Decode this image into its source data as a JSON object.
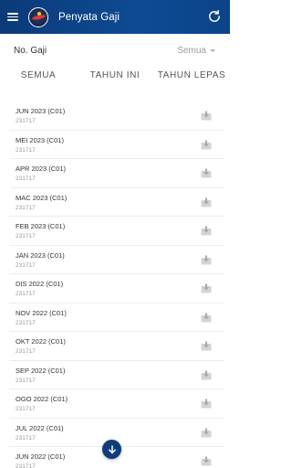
{
  "appbar": {
    "title": "Penyata Gaji",
    "menu_icon": "hamburger-menu-icon",
    "logo_icon": "app-logo",
    "refresh_icon": "refresh-icon",
    "color": "#0d4b94"
  },
  "filter": {
    "label": "No. Gaji",
    "selected": "Semua"
  },
  "tabs": [
    {
      "label": "SEMUA"
    },
    {
      "label": "TAHUN INI"
    },
    {
      "label": "TAHUN LEPAS"
    }
  ],
  "statements": [
    {
      "month": "JUN 2023 (C01)",
      "code": "231717"
    },
    {
      "month": "MEI 2023 (C01)",
      "code": "231717"
    },
    {
      "month": "APR 2023 (C01)",
      "code": "231717"
    },
    {
      "month": "MAC 2023 (C01)",
      "code": "231717"
    },
    {
      "month": "FEB 2023 (C01)",
      "code": "231717"
    },
    {
      "month": "JAN 2023 (C01)",
      "code": "231717"
    },
    {
      "month": "DIS 2022 (C01)",
      "code": "231717"
    },
    {
      "month": "NOV 2022 (C01)",
      "code": "231717"
    },
    {
      "month": "OKT 2022 (C01)",
      "code": "231717"
    },
    {
      "month": "SEP 2022 (C01)",
      "code": "231717"
    },
    {
      "month": "OGO 2022 (C01)",
      "code": "231717"
    },
    {
      "month": "JUL 2022 (C01)",
      "code": "231717"
    },
    {
      "month": "JUN 2022 (C01)",
      "code": "231717"
    }
  ],
  "download_icon": "download-icon",
  "fab_icon": "arrow-down-icon"
}
